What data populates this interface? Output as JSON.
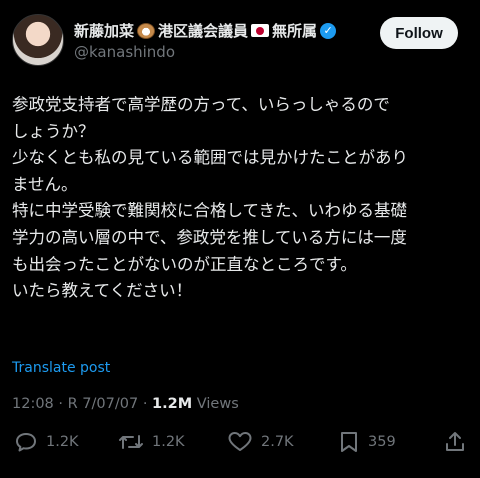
{
  "author": {
    "name": "新藤加菜",
    "name_suffix": "港区議会議員",
    "name_tail": "無所属",
    "handle": "@kanashindo",
    "follow_label": "Follow",
    "verified_icon": "✓"
  },
  "post": {
    "lines": [
      "参政党支持者で高学歴の方って、いらっしゃるので",
      "しょうか？",
      "少なくとも私の見ている範囲では見かけたことがあり",
      "ません。",
      "特に中学受験で難関校に合格してきた、いわゆる基礎",
      "学力の高い層の中で、参政党を推している方には一度",
      "も出会ったことがないのが正直なところです。",
      "いたら教えてください！"
    ],
    "translate_label": "Translate post"
  },
  "meta": {
    "time": "12:08",
    "separator": "·",
    "date": "R 7/07/07",
    "views_count": "1.2M",
    "views_label": "Views"
  },
  "actions": {
    "reply_count": "1.2K",
    "repost_count": "1.2K",
    "like_count": "2.7K",
    "bookmark_count": "359"
  },
  "colors": {
    "background": "#000000",
    "text": "#e7e9ea",
    "secondary": "#71767b",
    "link": "#1d9bf0",
    "verified": "#1d9bf0"
  }
}
